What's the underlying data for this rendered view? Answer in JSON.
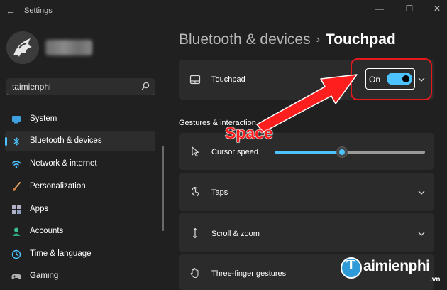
{
  "window": {
    "title": "Settings",
    "back_glyph": "←",
    "minimize_glyph": "—",
    "maximize_glyph": "☐",
    "close_glyph": "✕"
  },
  "search": {
    "value": "taimienphi"
  },
  "nav": {
    "items": [
      {
        "label": "System",
        "icon": "monitor-icon",
        "selected": false
      },
      {
        "label": "Bluetooth & devices",
        "icon": "bluetooth-icon",
        "selected": true
      },
      {
        "label": "Network & internet",
        "icon": "wifi-icon",
        "selected": false
      },
      {
        "label": "Personalization",
        "icon": "brush-icon",
        "selected": false
      },
      {
        "label": "Apps",
        "icon": "apps-icon",
        "selected": false
      },
      {
        "label": "Accounts",
        "icon": "person-icon",
        "selected": false
      },
      {
        "label": "Time & language",
        "icon": "globe-clock-icon",
        "selected": false
      },
      {
        "label": "Gaming",
        "icon": "gamepad-icon",
        "selected": false
      }
    ]
  },
  "breadcrumb": {
    "parent": "Bluetooth & devices",
    "separator": "›",
    "current": "Touchpad"
  },
  "touchpad_card": {
    "label": "Touchpad",
    "toggle_label": "On",
    "toggle_on": true
  },
  "gestures": {
    "header": "Gestures & interaction",
    "cursor_speed": {
      "label": "Cursor speed",
      "value_fraction": 0.45
    },
    "taps": "Taps",
    "scroll_zoom": "Scroll & zoom",
    "three_finger": "Three-finger gestures"
  },
  "annotation": {
    "text": "Space"
  },
  "watermark": {
    "brand": "aimienphi",
    "initial": "T",
    "suffix": ".vn"
  },
  "colors": {
    "accent": "#4cc2ff",
    "highlight": "#e3191b",
    "background": "#202020",
    "card": "#2b2b2b"
  }
}
